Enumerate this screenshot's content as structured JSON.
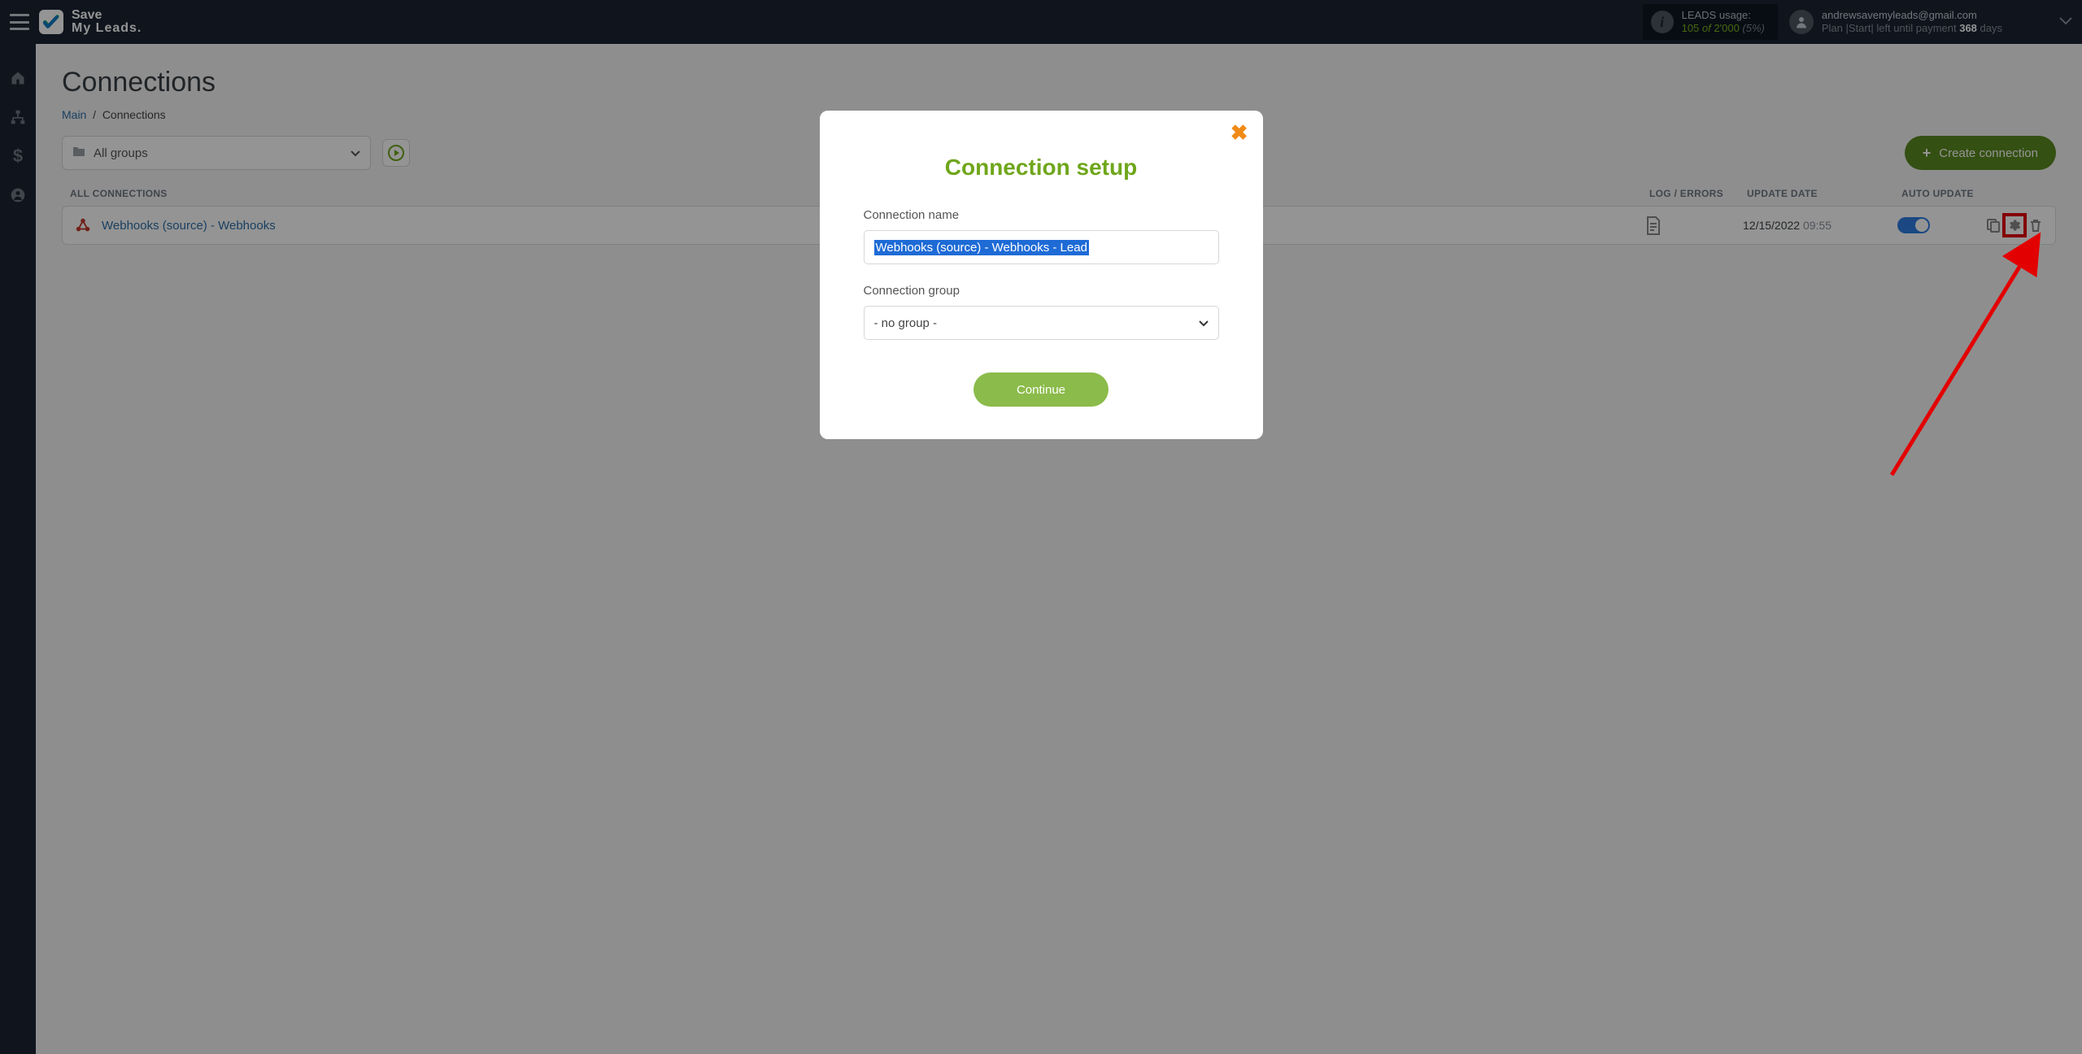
{
  "brand": {
    "line1": "Save",
    "line2": "My Leads."
  },
  "header": {
    "usage_label": "LEADS usage:",
    "usage_used": "105",
    "usage_of": "of",
    "usage_total": "2'000",
    "usage_pct": "(5%)",
    "email": "andrewsavemyleads@gmail.com",
    "plan_pre": "Plan |Start| left until payment ",
    "plan_days": "368",
    "plan_post": " days"
  },
  "page": {
    "title": "Connections",
    "breadcrumb_main": "Main",
    "breadcrumb_current": "Connections"
  },
  "filters": {
    "group_label": "All groups",
    "create_label": "Create connection"
  },
  "table": {
    "th_name": "ALL CONNECTIONS",
    "th_log": "LOG / ERRORS",
    "th_date": "UPDATE DATE",
    "th_auto": "AUTO UPDATE",
    "row": {
      "name": "Webhooks (source) - Webhooks",
      "date": "12/15/2022",
      "time": "09:55"
    }
  },
  "modal": {
    "title": "Connection setup",
    "name_label": "Connection name",
    "name_value": "Webhooks (source) - Webhooks - Lead",
    "group_label": "Connection group",
    "group_value": "- no group -",
    "continue": "Continue"
  }
}
